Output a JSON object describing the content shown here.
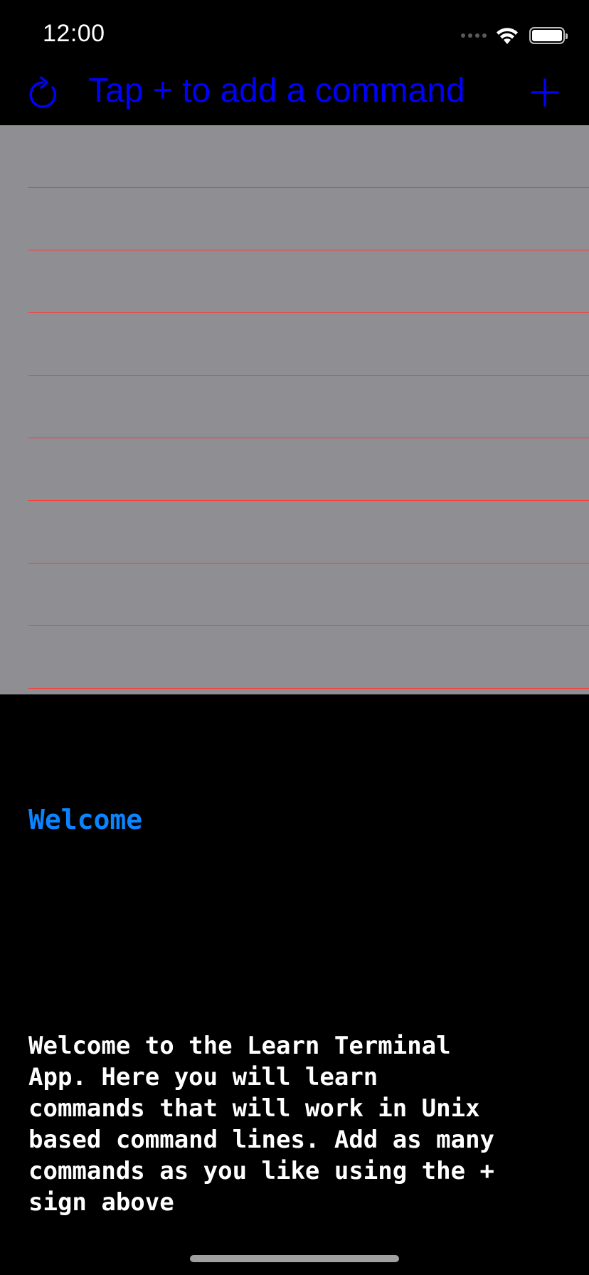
{
  "status_bar": {
    "time": "12:00",
    "battery_level": 1.0
  },
  "nav": {
    "title": "Tap + to add a command",
    "refresh_icon": "refresh-icon",
    "add_icon": "plus-icon",
    "accent_color": "#0000ff"
  },
  "command_list": {
    "background_color": "#8e8e93",
    "separator_color": "#ff3b30",
    "rows": [
      "",
      "",
      "",
      "",
      "",
      "",
      "",
      "",
      ""
    ]
  },
  "content": {
    "heading": "Welcome",
    "heading_color": "#0a84ff",
    "body": "Welcome to the Learn Terminal\nApp. Here you will learn\ncommands that will work in Unix\nbased command lines. Add as many\ncommands as you like using the +\nsign above"
  }
}
